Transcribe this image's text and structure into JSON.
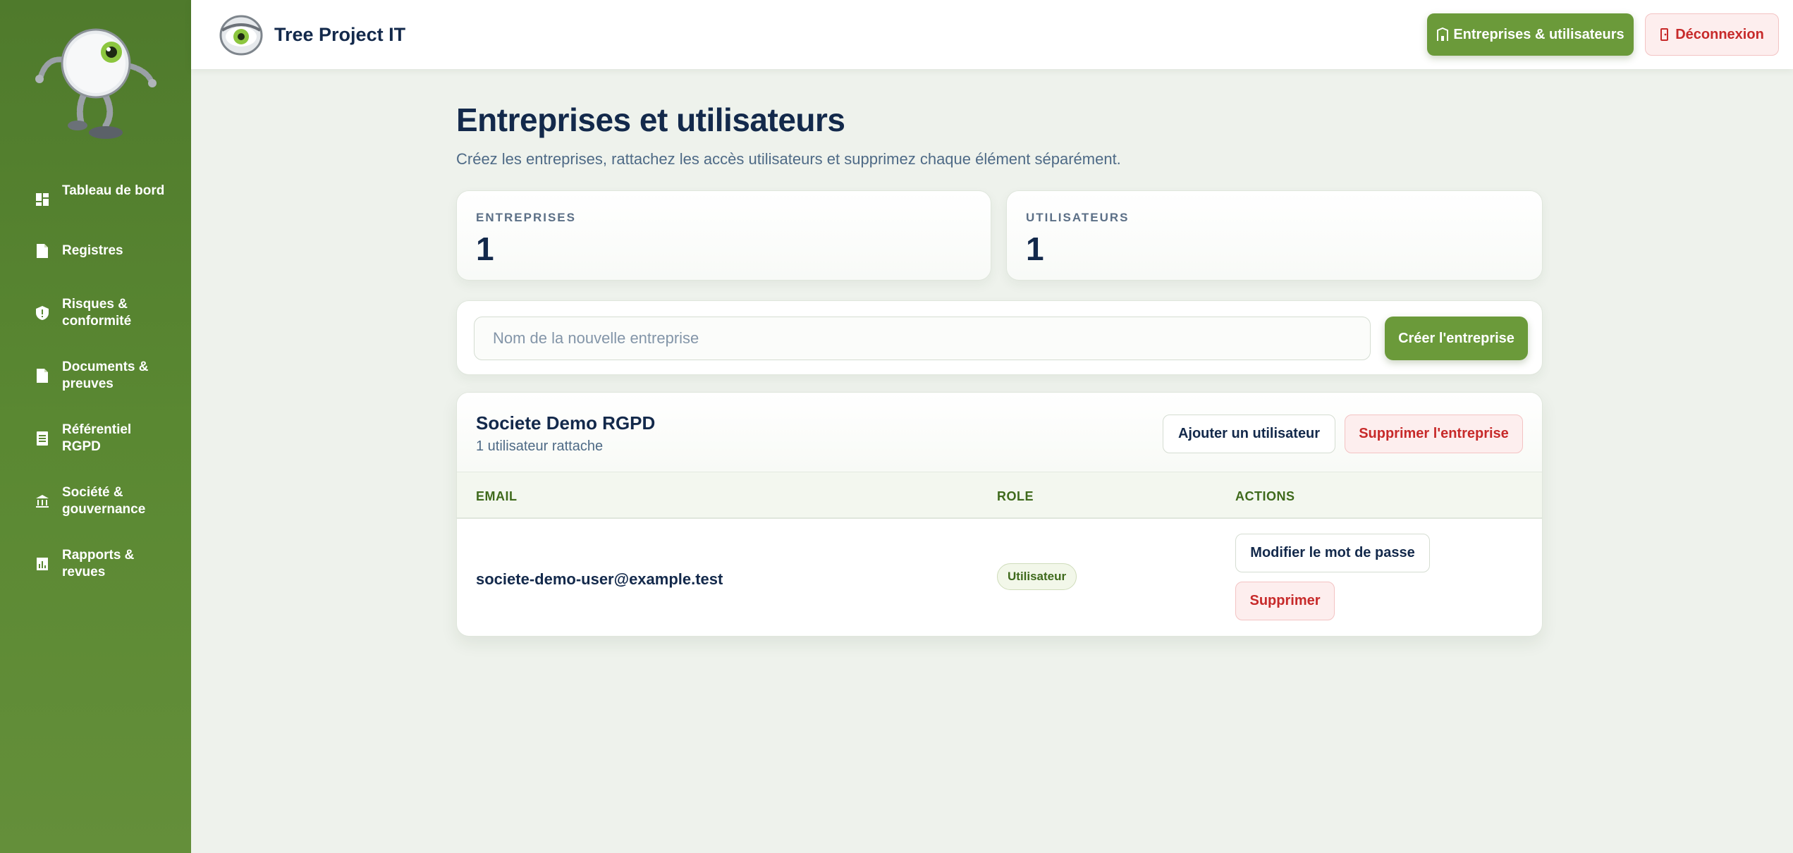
{
  "app": {
    "name": "Tree Project IT"
  },
  "colors": {
    "accent": "#6b9a3a",
    "sidebar": "#5a8832",
    "navy": "#13294b",
    "danger": "#c72a2a"
  },
  "sidebar": {
    "items": [
      {
        "label": "Tableau de bord",
        "icon": "dashboard-icon"
      },
      {
        "label": "Registres",
        "icon": "document-icon"
      },
      {
        "label": "Risques & conformité",
        "icon": "shield-icon"
      },
      {
        "label": "Documents & preuves",
        "icon": "file-icon"
      },
      {
        "label": "Référentiel RGPD",
        "icon": "list-document-icon"
      },
      {
        "label": "Société & gouvernance",
        "icon": "institution-icon"
      },
      {
        "label": "Rapports & revues",
        "icon": "report-chart-icon"
      }
    ]
  },
  "topbar": {
    "companies_button": "Entreprises & utilisateurs",
    "logout_button": "Déconnexion"
  },
  "main": {
    "title": "Entreprises et utilisateurs",
    "subtitle": "Créez les entreprises, rattachez les accès utilisateurs et supprimez chaque élément séparément.",
    "stats": [
      {
        "label": "ENTREPRISES",
        "value": "1"
      },
      {
        "label": "UTILISATEURS",
        "value": "1"
      }
    ],
    "create": {
      "placeholder": "Nom de la nouvelle entreprise",
      "button": "Créer l'entreprise"
    },
    "company": {
      "name": "Societe Demo RGPD",
      "user_count": "1 utilisateur rattache",
      "add_user_button": "Ajouter un utilisateur",
      "delete_button": "Supprimer l'entreprise",
      "columns": [
        "EMAIL",
        "ROLE",
        "ACTIONS"
      ],
      "users": [
        {
          "email": "societe-demo-user@example.test",
          "role": "Utilisateur",
          "change_password": "Modifier le mot de passe",
          "delete": "Supprimer"
        }
      ]
    }
  }
}
